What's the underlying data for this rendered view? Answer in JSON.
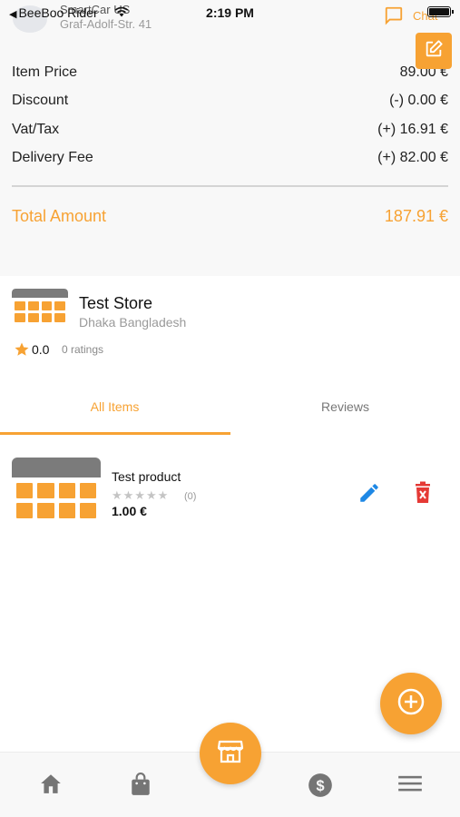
{
  "status_bar": {
    "back_label": "BeeBoo Rider",
    "time": "2:19 PM"
  },
  "header": {
    "store_title": "SmartCar US",
    "store_address": "Graf-Adolf-Str. 41",
    "chat_label": "Chat"
  },
  "summary": {
    "rows": [
      {
        "label": "Item Price",
        "value": "89.00 €"
      },
      {
        "label": "Discount",
        "value": "(-) 0.00 €"
      },
      {
        "label": "Vat/Tax",
        "value": "(+) 16.91 €"
      },
      {
        "label": "Delivery Fee",
        "value": "(+) 82.00 €"
      }
    ],
    "total_label": "Total Amount",
    "total_value": "187.91 €"
  },
  "store": {
    "name": "Test Store",
    "address": "Dhaka Bangladesh",
    "rating": "0.0",
    "ratings_count": "0 ratings"
  },
  "tabs": [
    {
      "label": "All Items",
      "active": true
    },
    {
      "label": "Reviews",
      "active": false
    }
  ],
  "products": [
    {
      "name": "Test product",
      "stars": "★★★★★",
      "review_count": "(0)",
      "price": "1.00 €"
    }
  ],
  "icons": {
    "chat": "chat-bubble-icon",
    "edit": "edit-icon",
    "star": "star-icon",
    "pencil": "pencil-icon",
    "delete": "trash-icon",
    "add": "add-circle-icon",
    "store": "store-icon",
    "home": "home-icon",
    "orders": "shopping-bag-icon",
    "earnings": "dollar-icon",
    "menu": "menu-icon"
  },
  "colors": {
    "accent": "#f7a233",
    "edit_blue": "#1e88e5",
    "delete_red": "#e53935",
    "nav_icon": "#757575"
  }
}
